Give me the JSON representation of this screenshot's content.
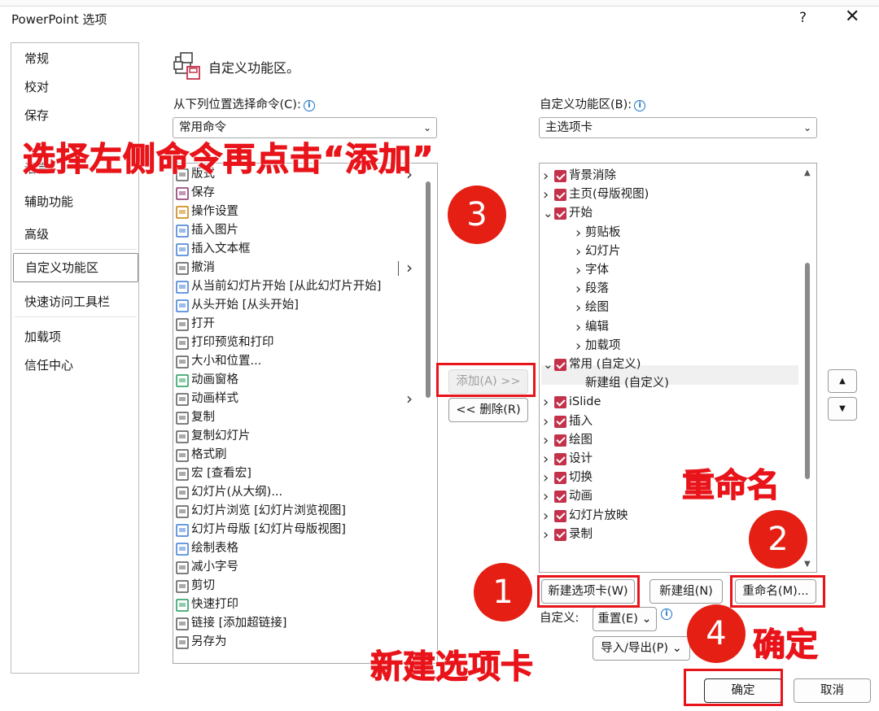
{
  "window": {
    "title": "PowerPoint 选项",
    "help": "?",
    "close": "✕"
  },
  "nav": {
    "items": [
      "常规",
      "校对",
      "保存",
      "语言",
      "辅助功能",
      "高级",
      "自定义功能区",
      "快速访问工具栏",
      "加载项",
      "信任中心"
    ],
    "selected": "自定义功能区"
  },
  "header": {
    "title": "自定义功能区。"
  },
  "left": {
    "choose_label": "从下列位置选择命令(C):",
    "choose_value": "常用命令",
    "commands": [
      {
        "label": "版式",
        "icon": "layout-icon",
        "arrow": true
      },
      {
        "label": "保存",
        "icon": "save-icon"
      },
      {
        "label": "操作设置",
        "icon": "action-icon"
      },
      {
        "label": "插入图片",
        "icon": "picture-icon"
      },
      {
        "label": "插入文本框",
        "icon": "textbox-icon"
      },
      {
        "label": "撤消",
        "icon": "undo-icon",
        "split": true
      },
      {
        "label": "从当前幻灯片开始 [从此幻灯片开始]",
        "icon": "slideshow-current-icon"
      },
      {
        "label": "从头开始 [从头开始]",
        "icon": "slideshow-start-icon"
      },
      {
        "label": "打开",
        "icon": "open-icon"
      },
      {
        "label": "打印预览和打印",
        "icon": "print-preview-icon"
      },
      {
        "label": "大小和位置...",
        "icon": "size-icon"
      },
      {
        "label": "动画窗格",
        "icon": "animation-pane-icon"
      },
      {
        "label": "动画样式",
        "icon": "animation-style-icon",
        "arrow": true
      },
      {
        "label": "复制",
        "icon": "copy-icon"
      },
      {
        "label": "复制幻灯片",
        "icon": "duplicate-slide-icon"
      },
      {
        "label": "格式刷",
        "icon": "format-painter-icon"
      },
      {
        "label": "宏 [查看宏]",
        "icon": "macro-icon"
      },
      {
        "label": "幻灯片(从大纲)...",
        "icon": "outline-icon"
      },
      {
        "label": "幻灯片浏览 [幻灯片浏览视图]",
        "icon": "slide-sorter-icon"
      },
      {
        "label": "幻灯片母版 [幻灯片母版视图]",
        "icon": "slide-master-icon"
      },
      {
        "label": "绘制表格",
        "icon": "draw-table-icon"
      },
      {
        "label": "减小字号",
        "icon": "decrease-font-icon"
      },
      {
        "label": "剪切",
        "icon": "cut-icon"
      },
      {
        "label": "快速打印",
        "icon": "quick-print-icon"
      },
      {
        "label": "链接 [添加超链接]",
        "icon": "link-icon"
      },
      {
        "label": "另存为",
        "icon": "save-as-icon"
      }
    ]
  },
  "mid": {
    "add_label": "添加(A) >>",
    "remove_label": "<< 删除(R)"
  },
  "right": {
    "customize_label": "自定义功能区(B):",
    "customize_value": "主选项卡",
    "tree": [
      {
        "label": "背景消除",
        "level": 0,
        "twist": ">",
        "checked": true
      },
      {
        "label": "主页(母版视图)",
        "level": 0,
        "twist": ">",
        "checked": true
      },
      {
        "label": "开始",
        "level": 0,
        "twist": "v",
        "checked": true
      },
      {
        "label": "剪贴板",
        "level": 1,
        "twist": ">"
      },
      {
        "label": "幻灯片",
        "level": 1,
        "twist": ">"
      },
      {
        "label": "字体",
        "level": 1,
        "twist": ">"
      },
      {
        "label": "段落",
        "level": 1,
        "twist": ">"
      },
      {
        "label": "绘图",
        "level": 1,
        "twist": ">"
      },
      {
        "label": "编辑",
        "level": 1,
        "twist": ">"
      },
      {
        "label": "加载项",
        "level": 1,
        "twist": ">"
      },
      {
        "label": "常用 (自定义)",
        "level": 0,
        "twist": "v",
        "checked": true,
        "highlight": true
      },
      {
        "label": "新建组 (自定义)",
        "level": 2,
        "twist": ""
      },
      {
        "label": "iSlide",
        "level": 0,
        "twist": ">",
        "checked": true
      },
      {
        "label": "插入",
        "level": 0,
        "twist": ">",
        "checked": true
      },
      {
        "label": "绘图",
        "level": 0,
        "twist": ">",
        "checked": true
      },
      {
        "label": "设计",
        "level": 0,
        "twist": ">",
        "checked": true
      },
      {
        "label": "切换",
        "level": 0,
        "twist": ">",
        "checked": true
      },
      {
        "label": "动画",
        "level": 0,
        "twist": ">",
        "checked": true
      },
      {
        "label": "幻灯片放映",
        "level": 0,
        "twist": ">",
        "checked": true
      },
      {
        "label": "录制",
        "level": 0,
        "twist": ">",
        "checked": true
      }
    ],
    "new_tab": "新建选项卡(W)",
    "new_group": "新建组(N)",
    "rename": "重命名(M)...",
    "customize_prefix": "自定义:",
    "reset": "重置(E) ⌄",
    "import_export": "导入/导出(P) ⌄"
  },
  "footer": {
    "ok": "确定",
    "cancel": "取消"
  },
  "annotations": {
    "instruction": "选择左侧命令再点击“添加”",
    "rename_hint": "重命名",
    "new_tab_hint": "新建选项卡",
    "ok_hint": "确定",
    "num1": "1",
    "num2": "2",
    "num3": "3",
    "num4": "4"
  },
  "colors": {
    "annotation_red": "#e8141a",
    "checkbox_red": "#c4314b"
  }
}
